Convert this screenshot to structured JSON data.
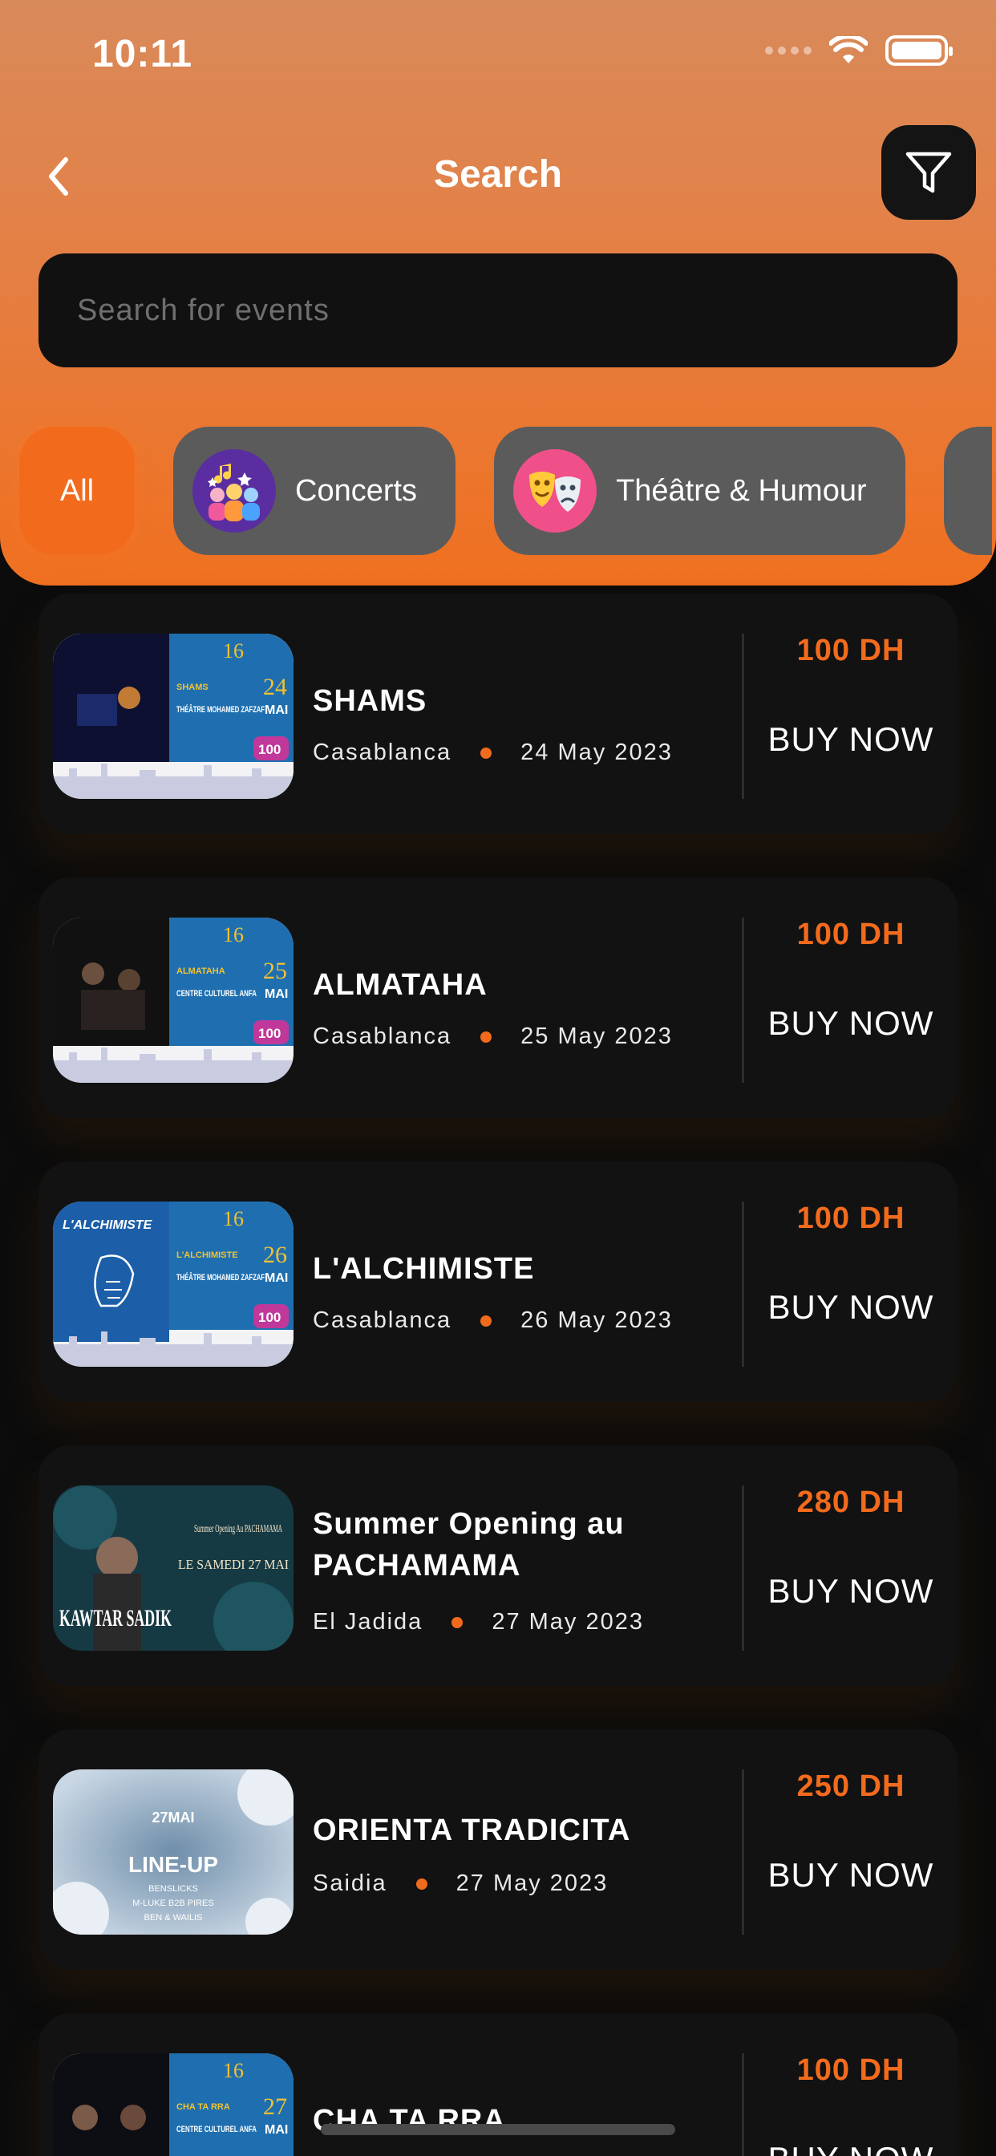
{
  "status_bar": {
    "time": "10:11"
  },
  "header": {
    "title": "Search"
  },
  "search": {
    "placeholder": "Search for events",
    "value": ""
  },
  "categories": [
    {
      "label": "All",
      "active": true
    },
    {
      "label": "Concerts",
      "active": false,
      "icon": "concerts-icon"
    },
    {
      "label": "Théâtre & Humour",
      "active": false,
      "icon": "theatre-masks-icon"
    }
  ],
  "events": [
    {
      "title": "SHAMS",
      "city": "Casablanca",
      "date": "24 May 2023",
      "price": "100 DH",
      "cta": "BUY NOW",
      "thumb": {
        "day": "24",
        "month": "MAI",
        "name": "SHAMS",
        "venue": "THÉÂTRE MOHAMED ZAFZAF",
        "ticket": "100",
        "festival": "16"
      }
    },
    {
      "title": "ALMATAHA",
      "city": "Casablanca",
      "date": "25 May 2023",
      "price": "100 DH",
      "cta": "BUY NOW",
      "thumb": {
        "day": "25",
        "month": "MAI",
        "name": "ALMATAHA",
        "venue": "CENTRE CULTUREL ANFA",
        "ticket": "100",
        "festival": "16"
      }
    },
    {
      "title": "L'ALCHIMISTE",
      "city": "Casablanca",
      "date": "26 May 2023",
      "price": "100 DH",
      "cta": "BUY NOW",
      "thumb": {
        "day": "26",
        "month": "MAI",
        "name": "L'ALCHIMISTE",
        "venue": "THÉÂTRE MOHAMED ZAFZAF",
        "ticket": "100",
        "festival": "16"
      }
    },
    {
      "title": "Summer Opening au PACHAMAMA",
      "city": "El Jadida",
      "date": "27 May 2023",
      "price": "280 DH",
      "cta": "BUY NOW",
      "thumb": {
        "headline": "Summer Opening Au PACHAMAMA",
        "date_line": "LE SAMEDI 27 MAI",
        "artist": "KAWTAR SADIK"
      }
    },
    {
      "title": "ORIENTA TRADICITA",
      "city": "Saidia",
      "date": "27 May 2023",
      "price": "250 DH",
      "cta": "BUY NOW",
      "thumb": {
        "date_line": "27MAI",
        "headline": "LINE-UP",
        "lineup": [
          "BENSLICKS",
          "M-LUKE B2B PIRES",
          "BEN & WAILIS"
        ]
      }
    },
    {
      "title": "CHA TA RRA",
      "city": "",
      "date": "",
      "price": "100 DH",
      "cta": "BUY NOW",
      "thumb": {
        "day": "27",
        "month": "MAI",
        "name": "CHA TA RRA",
        "venue": "CENTRE CULTUREL ANFA",
        "ticket": "",
        "festival": "16"
      }
    }
  ],
  "colors": {
    "accent": "#f26b1d",
    "card": "#121212",
    "background": "#0c0c0c"
  }
}
